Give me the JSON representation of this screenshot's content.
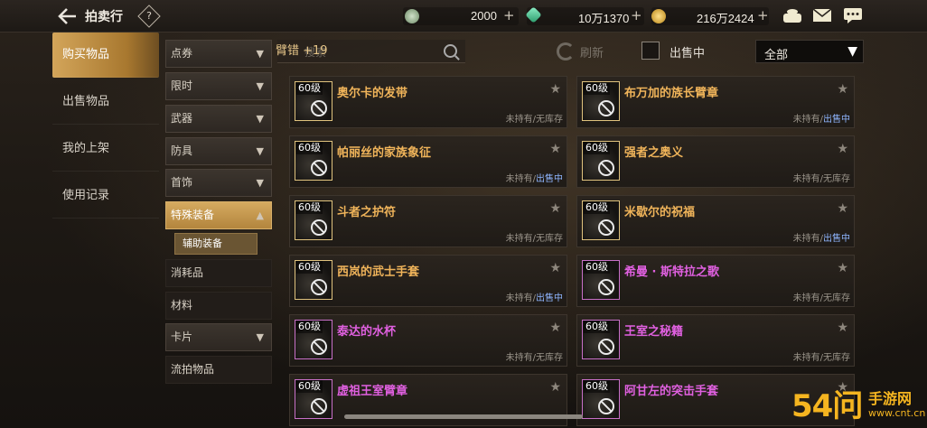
{
  "header": {
    "title": "拍卖行",
    "help_label": "?",
    "currencies": [
      {
        "icon": "silver-coin-icon",
        "value": "2000",
        "color": "#8fb08a"
      },
      {
        "icon": "green-gem-icon",
        "value": "10万1370",
        "color": "#4fc49a"
      },
      {
        "icon": "gold-coin-icon",
        "value": "216万2424",
        "color": "#e2b23a"
      }
    ],
    "plus_label": "+",
    "right_icons": [
      "bag-icon",
      "mail-icon",
      "chat-icon"
    ]
  },
  "leftmenu": {
    "items": [
      {
        "label": "购买物品",
        "active": true
      },
      {
        "label": "出售物品",
        "active": false
      },
      {
        "label": "我的上架",
        "active": false
      },
      {
        "label": "使用记录",
        "active": false
      }
    ]
  },
  "categories": {
    "items": [
      {
        "label": "点券",
        "type": "collapsed"
      },
      {
        "label": "限时",
        "type": "collapsed"
      },
      {
        "label": "武器",
        "type": "collapsed"
      },
      {
        "label": "防具",
        "type": "collapsed"
      },
      {
        "label": "首饰",
        "type": "collapsed"
      },
      {
        "label": "特殊装备",
        "type": "open"
      },
      {
        "label": "消耗品",
        "type": "plain"
      },
      {
        "label": "材料",
        "type": "plain"
      },
      {
        "label": "卡片",
        "type": "collapsed"
      },
      {
        "label": "流拍物品",
        "type": "plain"
      }
    ],
    "subcategory": "辅助装备"
  },
  "search": {
    "tag": "臂错 +19",
    "placeholder": "搜索",
    "refresh_label": "刷新",
    "sell_filter_label": "出售中",
    "dropdown_value": "全部"
  },
  "items": [
    {
      "level": "60级",
      "name": "奥尔卡的发带",
      "rarity": "orange",
      "status_a": "未持有",
      "status_b": "无库存",
      "b_selling": false
    },
    {
      "level": "60级",
      "name": "布万加的族长臂章",
      "rarity": "orange",
      "status_a": "未持有",
      "status_b": "出售中",
      "b_selling": true
    },
    {
      "level": "60级",
      "name": "帕丽丝的家族象征",
      "rarity": "orange",
      "status_a": "未持有",
      "status_b": "出售中",
      "b_selling": true
    },
    {
      "level": "60级",
      "name": "强者之奥义",
      "rarity": "orange",
      "status_a": "未持有",
      "status_b": "无库存",
      "b_selling": false
    },
    {
      "level": "60级",
      "name": "斗者之护符",
      "rarity": "orange",
      "status_a": "未持有",
      "status_b": "无库存",
      "b_selling": false
    },
    {
      "level": "60级",
      "name": "米歇尔的祝福",
      "rarity": "orange",
      "status_a": "未持有",
      "status_b": "出售中",
      "b_selling": true
    },
    {
      "level": "60级",
      "name": "西岚的武士手套",
      "rarity": "orange",
      "status_a": "未持有",
      "status_b": "出售中",
      "b_selling": true
    },
    {
      "level": "60级",
      "name": "希曼 · 斯特拉之歌",
      "rarity": "pink",
      "status_a": "未持有",
      "status_b": "无库存",
      "b_selling": false
    },
    {
      "level": "60级",
      "name": "泰达的水杯",
      "rarity": "pink",
      "status_a": "未持有",
      "status_b": "无库存",
      "b_selling": false
    },
    {
      "level": "60级",
      "name": "王室之秘籍",
      "rarity": "pink",
      "status_a": "未持有",
      "status_b": "无库存",
      "b_selling": false
    },
    {
      "level": "60级",
      "name": "虚祖王室臂章",
      "rarity": "pink",
      "status_a": "",
      "status_b": "",
      "b_selling": false
    },
    {
      "level": "60级",
      "name": "阿甘左的突击手套",
      "rarity": "pink",
      "status_a": "",
      "status_b": "",
      "b_selling": false
    }
  ],
  "status_separator": "/",
  "watermark": {
    "logo": "54问",
    "text": "手游网",
    "url": "www.cnt.cn"
  }
}
